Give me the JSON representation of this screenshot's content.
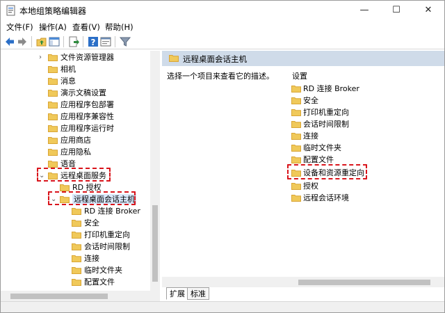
{
  "window": {
    "title": "本地组策略编辑器",
    "controls": {
      "minimize": "—",
      "maximize": "☐",
      "close": "✕"
    }
  },
  "menu": {
    "items": [
      "文件(F)",
      "操作(A)",
      "查看(V)",
      "帮助(H)"
    ]
  },
  "toolbar": {
    "icons": [
      "back-arrow-icon",
      "forward-arrow-icon",
      "up-folder-icon",
      "show-hide-tree-icon",
      "export-list-icon",
      "help-icon",
      "properties-icon",
      "filter-icon"
    ]
  },
  "tree": {
    "items": [
      {
        "label": "文件资源管理器",
        "expander": "›"
      },
      {
        "label": "相机"
      },
      {
        "label": "消息"
      },
      {
        "label": "演示文稿设置"
      },
      {
        "label": "应用程序包部署"
      },
      {
        "label": "应用程序兼容性"
      },
      {
        "label": "应用程序运行时"
      },
      {
        "label": "应用商店"
      },
      {
        "label": "应用隐私"
      },
      {
        "label": "语音"
      },
      {
        "label": "远程桌面服务",
        "expander": "⌄",
        "highlighted": true
      },
      {
        "label": "RD 授权"
      },
      {
        "label": "远程桌面会话主机",
        "expander": "⌄",
        "highlighted": true,
        "selected": true
      },
      {
        "label": "RD 连接 Broker"
      },
      {
        "label": "安全"
      },
      {
        "label": "打印机重定向"
      },
      {
        "label": "会话时间限制"
      },
      {
        "label": "连接"
      },
      {
        "label": "临时文件夹"
      },
      {
        "label": "配置文件"
      }
    ]
  },
  "right_pane": {
    "header_title": "远程桌面会话主机",
    "description": "选择一个项目来查看它的描述。",
    "column_header": "设置",
    "items": [
      {
        "label": "RD 连接 Broker"
      },
      {
        "label": "安全"
      },
      {
        "label": "打印机重定向"
      },
      {
        "label": "会话时间限制"
      },
      {
        "label": "连接"
      },
      {
        "label": "临时文件夹"
      },
      {
        "label": "配置文件"
      },
      {
        "label": "设备和资源重定向",
        "highlighted": true
      },
      {
        "label": "授权"
      },
      {
        "label": "远程会话环境"
      }
    ]
  },
  "tabs": {
    "items": [
      "扩展",
      "标准"
    ],
    "active": "扩展"
  },
  "colors": {
    "highlight_dash": "#d9141b",
    "header_band": "#cfdbe9",
    "folder_fill": "#f0c95a",
    "folder_edge": "#d9a534"
  }
}
